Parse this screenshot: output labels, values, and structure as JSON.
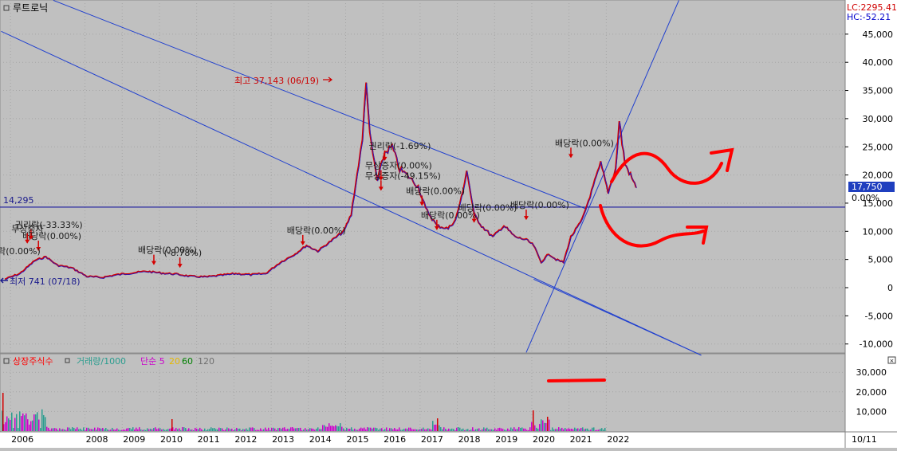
{
  "stock_name": "루트로닉",
  "corner_indicators": {
    "lc": "LC:2295.41",
    "hc": "HC:-52.21"
  },
  "current_price_label": "17,750",
  "pct_label": "0.00%",
  "hline_label": "14,295",
  "max_annotation": "최고 37,143 (06/19)",
  "min_annotation": "최저 741 (07/18)",
  "corner_date": "10/11",
  "event_labels": [
    {
      "text": "배당락(0.00%)",
      "date": "2013.8",
      "price": 8500
    },
    {
      "text": "배당락(0.00%)",
      "date": "2009.8",
      "price": 5000
    },
    {
      "text": "(-8.78%)",
      "date": "2010.5",
      "price": 4500
    },
    {
      "text": "배당락(0.00%)",
      "date": "2006.7",
      "price": 7500
    },
    {
      "text": "권리락(-33.33%)",
      "date": "2006.5",
      "price": 9500
    },
    {
      "text": "배당락(0.00%)",
      "date": "2005.6",
      "price": 4800
    },
    {
      "text": "무상증자",
      "date": "2006.4",
      "price": 8800
    },
    {
      "text": "권리락(-1.69%)",
      "date": "2016.0",
      "price": 23500
    },
    {
      "text": "무상증자(0.00%)",
      "date": "2015.9",
      "price": 20000
    },
    {
      "text": "무상증자(-49.15%)",
      "date": "2015.9",
      "price": 18200
    },
    {
      "text": "배당락(0.00%)",
      "date": "2017.0",
      "price": 15500
    },
    {
      "text": "배당락(0.00%)",
      "date": "2017.4",
      "price": 11200
    },
    {
      "text": "배당락(0.00%)",
      "date": "2018.4",
      "price": 12500
    },
    {
      "text": "배당락(0.00%)",
      "date": "2019.8",
      "price": 13000
    },
    {
      "text": "배당락(0.00%)",
      "date": "2021.0",
      "price": 24000
    }
  ],
  "volume_legend": [
    {
      "text": "상장주식수",
      "color": "#ff0000"
    },
    {
      "text": "거래량/1000",
      "color": "#2a9d8f"
    },
    {
      "text": "단순 5",
      "color": "#cc00cc"
    },
    {
      "text": "20",
      "color": "#e6b800"
    },
    {
      "text": "60",
      "color": "#008000"
    },
    {
      "text": "120",
      "color": "#707070"
    }
  ],
  "chart_data": {
    "type": "line",
    "price_axis": {
      "ticks": [
        45000,
        40000,
        35000,
        30000,
        25000,
        20000,
        15000,
        10000,
        5000,
        0,
        -5000,
        -10000
      ]
    },
    "volume_axis": {
      "ticks": [
        30000,
        20000,
        10000
      ]
    },
    "x_axis": {
      "ticks": [
        "2006",
        "2008",
        "2009",
        "2010",
        "2011",
        "2012",
        "2013",
        "2014",
        "2015",
        "2016",
        "2017",
        "2018",
        "2019",
        "2020",
        "2021",
        "2022"
      ]
    },
    "price_series": {
      "name": "",
      "points": [
        [
          "2005.8",
          1500
        ],
        [
          "2006.2",
          2500
        ],
        [
          "2006.6",
          4800
        ],
        [
          "2006.9",
          5500
        ],
        [
          "2007.2",
          4000
        ],
        [
          "2007.6",
          3500
        ],
        [
          "2008.0",
          2000
        ],
        [
          "2008.4",
          1800
        ],
        [
          "2008.8",
          2300
        ],
        [
          "2009.2",
          2600
        ],
        [
          "2009.6",
          2900
        ],
        [
          "2010.0",
          2600
        ],
        [
          "2010.4",
          2400
        ],
        [
          "2010.8",
          2000
        ],
        [
          "2011.2",
          1900
        ],
        [
          "2011.6",
          2200
        ],
        [
          "2012.0",
          2500
        ],
        [
          "2012.4",
          2300
        ],
        [
          "2012.8",
          2500
        ],
        [
          "2013.2",
          4500
        ],
        [
          "2013.6",
          6000
        ],
        [
          "2013.9",
          7500
        ],
        [
          "2014.2",
          6500
        ],
        [
          "2014.6",
          8500
        ],
        [
          "2014.9",
          10000
        ],
        [
          "2015.1",
          13000
        ],
        [
          "2015.3",
          22000
        ],
        [
          "2015.4",
          26000
        ],
        [
          "2015.5",
          37143
        ],
        [
          "2015.6",
          27000
        ],
        [
          "2015.8",
          19000
        ],
        [
          "2016.0",
          24000
        ],
        [
          "2016.2",
          25000
        ],
        [
          "2016.4",
          21000
        ],
        [
          "2016.6",
          20000
        ],
        [
          "2016.9",
          18000
        ],
        [
          "2017.1",
          14000
        ],
        [
          "2017.4",
          11000
        ],
        [
          "2017.7",
          10500
        ],
        [
          "2017.9",
          12000
        ],
        [
          "2018.1",
          17000
        ],
        [
          "2018.2",
          21000
        ],
        [
          "2018.4",
          13000
        ],
        [
          "2018.6",
          11000
        ],
        [
          "2018.9",
          9000
        ],
        [
          "2019.2",
          11000
        ],
        [
          "2019.5",
          9000
        ],
        [
          "2019.8",
          8500
        ],
        [
          "2020.0",
          7500
        ],
        [
          "2020.2",
          4500
        ],
        [
          "2020.4",
          6000
        ],
        [
          "2020.6",
          5000
        ],
        [
          "2020.8",
          4500
        ],
        [
          "2021.0",
          9000
        ],
        [
          "2021.3",
          12000
        ],
        [
          "2021.6",
          18000
        ],
        [
          "2021.8",
          22000
        ],
        [
          "2022.0",
          17000
        ],
        [
          "2022.2",
          21000
        ],
        [
          "2022.3",
          29500
        ],
        [
          "2022.45",
          22000
        ],
        [
          "2022.6",
          20000
        ],
        [
          "2022.75",
          17750
        ]
      ]
    },
    "horizontal_line": 14295,
    "trend_lines": [
      {
        "from": [
          "2005.7",
          45500
        ],
        "to": [
          "2024.5",
          -12000
        ]
      },
      {
        "from": [
          "2007.1",
          51000
        ],
        "to": [
          "2021.4",
          14000
        ]
      },
      {
        "from": [
          "2020.0",
          1500
        ],
        "to": [
          "2024.5",
          -12000
        ]
      },
      {
        "from": [
          "2019.8",
          -11500
        ],
        "to": [
          "2023.9",
          51000
        ]
      }
    ]
  }
}
